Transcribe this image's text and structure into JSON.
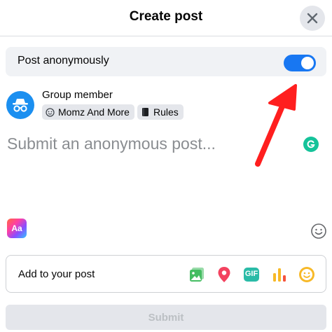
{
  "header": {
    "title": "Create post"
  },
  "anonymous": {
    "label": "Post anonymously",
    "enabled": true
  },
  "author": {
    "name": "Group member",
    "group_chip": "Momz And More",
    "rules_chip": "Rules"
  },
  "composer": {
    "placeholder": "Submit an anonymous post..."
  },
  "formatting": {
    "aa_label": "Aa"
  },
  "add_to_post": {
    "label": "Add to your post",
    "icons": [
      "photo-video-icon",
      "location-pin-icon",
      "gif-icon",
      "poll-icon",
      "feeling-emoji-icon"
    ],
    "gif_label": "GIF"
  },
  "submit": {
    "label": "Submit"
  },
  "colors": {
    "accent": "#1877f2",
    "annotation_arrow": "#ff1f1f",
    "photo": "#45bd62",
    "location": "#f3425f",
    "gif": "#2abba7",
    "poll": "#f7b928",
    "feeling": "#f7b928"
  }
}
